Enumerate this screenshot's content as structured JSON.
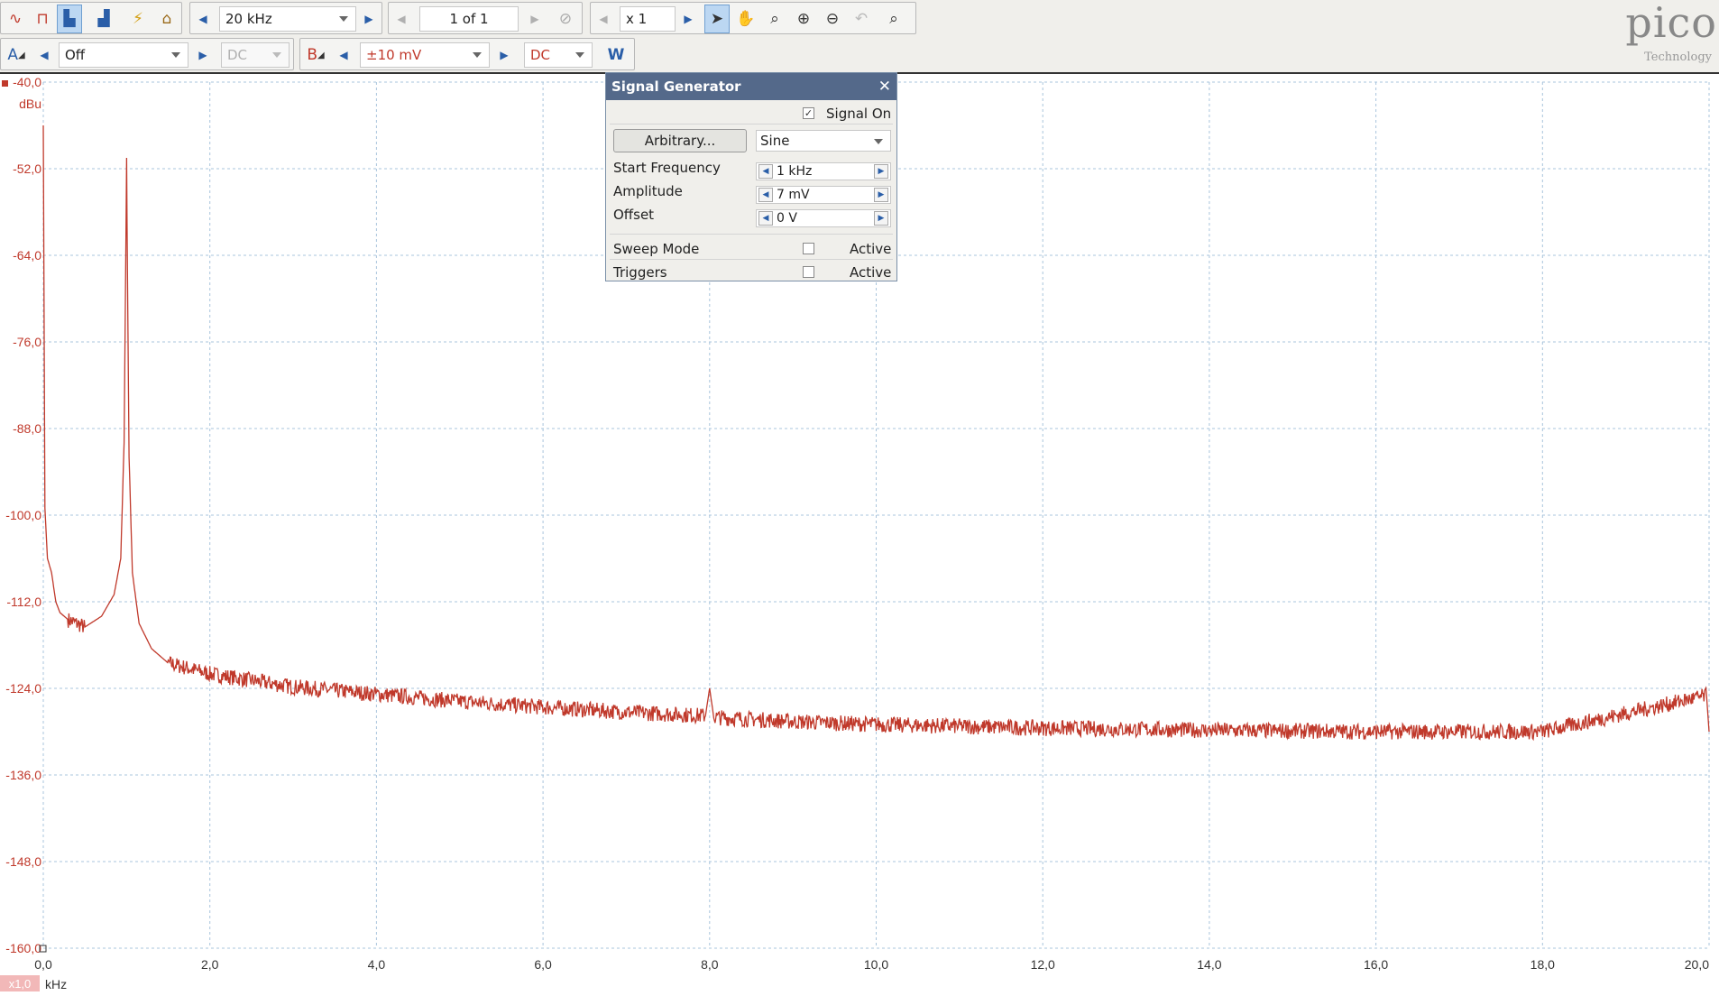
{
  "toolbar": {
    "mode_icons": [
      "scope-mode-icon",
      "persistence-mode-icon",
      "spectrum-mode-icon",
      "spectrum-persistence-icon",
      "auto-setup-icon",
      "home-icon"
    ],
    "timebase": "20 kHz",
    "page": "1 of 1",
    "zoom": "x 1",
    "tool_icons": [
      "pointer-icon",
      "hand-icon",
      "zoom-region-icon",
      "zoom-in-icon",
      "zoom-out-icon",
      "undo-zoom-icon",
      "zoom-fit-icon"
    ]
  },
  "channels": {
    "a_label": "A",
    "a_range": "Off",
    "a_coupling": "DC",
    "b_label": "B",
    "b_range": "±10 mV",
    "b_coupling": "DC"
  },
  "logo": {
    "word": "pico",
    "sub": "Technology"
  },
  "signal_generator": {
    "title": "Signal Generator",
    "signal_on_label": "Signal On",
    "signal_on": true,
    "arbitrary_button": "Arbitrary...",
    "waveform": "Sine",
    "start_frequency_label": "Start Frequency",
    "start_frequency": "1 kHz",
    "amplitude_label": "Amplitude",
    "amplitude": "7 mV",
    "offset_label": "Offset",
    "offset": "0 V",
    "sweep_mode_label": "Sweep Mode",
    "triggers_label": "Triggers",
    "active_label": "Active"
  },
  "chart_data": {
    "type": "line",
    "ylabel": "dBu",
    "xlabel": "kHz",
    "x_scale_badge": "x1,0",
    "ylim": [
      -160,
      -40
    ],
    "xlim": [
      0,
      20
    ],
    "y_ticks": [
      "-40,0",
      "-52,0",
      "-64,0",
      "-76,0",
      "-88,0",
      "-100,0",
      "-112,0",
      "-124,0",
      "-136,0",
      "-148,0",
      "-160,0"
    ],
    "x_ticks": [
      "0,0",
      "2,0",
      "4,0",
      "6,0",
      "8,0",
      "10,0",
      "12,0",
      "14,0",
      "16,0",
      "18,0",
      "20,0"
    ],
    "grid": true,
    "line_color": "#c0392b",
    "series": [
      {
        "x": [
          0.0,
          0.02,
          0.05,
          0.1,
          0.15,
          0.2,
          0.3,
          0.5,
          0.7,
          0.85,
          0.93,
          0.97,
          0.99,
          1.0,
          1.01,
          1.03,
          1.07,
          1.15,
          1.3,
          1.5,
          2.0,
          3.0,
          4.0,
          5.0,
          6.0,
          7.0,
          7.95,
          8.0,
          8.05,
          9.0,
          10.0,
          12.0,
          14.0,
          16.0,
          18.0,
          19.97,
          20.0
        ],
        "y": [
          -46.0,
          -99.0,
          -106.0,
          -108.0,
          -112.0,
          -113.5,
          -114.5,
          -115.5,
          -114.0,
          -111.0,
          -106.0,
          -90.0,
          -65.0,
          -50.5,
          -66.0,
          -92.0,
          -108.0,
          -115.0,
          -118.5,
          -120.5,
          -122.0,
          -123.8,
          -124.8,
          -125.8,
          -126.6,
          -127.3,
          -127.8,
          -124.0,
          -128.0,
          -128.6,
          -129.0,
          -129.5,
          -129.8,
          -130.0,
          -130.0,
          -125.0,
          -130.0
        ]
      }
    ]
  }
}
